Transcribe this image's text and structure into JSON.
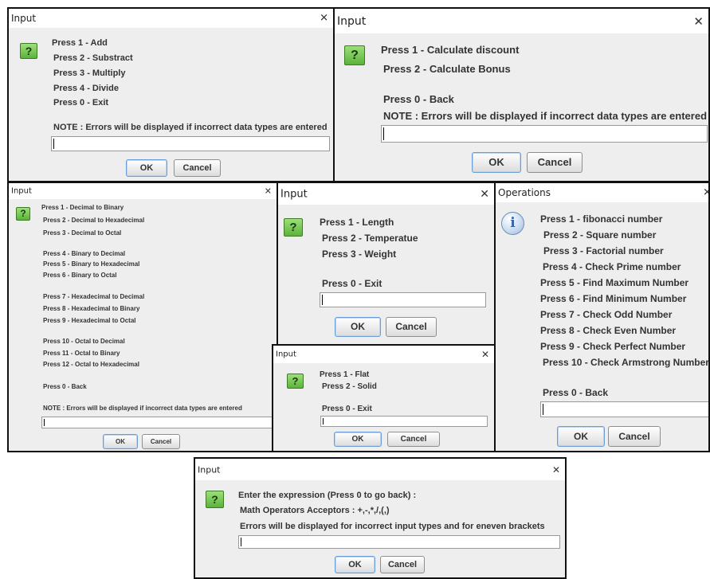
{
  "dialog_arith": {
    "title": "Input",
    "lines": [
      "Press 1 - Add",
      "Press 2 - Substract",
      "Press 3 - Multiply",
      "Press 4 - Divide",
      "Press 0 - Exit"
    ],
    "note": "NOTE : Errors will be displayed if incorrect data types are entered",
    "input_value": "",
    "ok": "OK",
    "cancel": "Cancel"
  },
  "dialog_discount": {
    "title": "Input",
    "lines": [
      "Press 1 - Calculate discount",
      "Press 2 - Calculate Bonus",
      "Press 0 - Back"
    ],
    "note": "NOTE : Errors will be displayed if incorrect data types are entered",
    "input_value": "",
    "ok": "OK",
    "cancel": "Cancel"
  },
  "dialog_convert": {
    "title": "Input",
    "lines": [
      "Press 1 - Decimal to Binary",
      "Press 2 - Decimal to Hexadecimal",
      "Press 3 - Decimal to Octal",
      "Press 4 - Binary to Decimal",
      "Press 5 - Binary to Hexadecimal",
      "Press 6 - Binary to Octal",
      "Press 7 - Hexadecimal to Decimal",
      "Press 8 - Hexadecimal to Binary",
      "Press 9 - Hexadecimal to Octal",
      "Press 10 - Octal to Decimal",
      "Press 11 - Octal to Binary",
      "Press 12 - Octal to Hexadecimal",
      "Press 0 - Back"
    ],
    "note": "NOTE : Errors will be displayed if incorrect data types are entered",
    "input_value": "",
    "ok": "OK",
    "cancel": "Cancel"
  },
  "dialog_units": {
    "title": "Input",
    "lines": [
      "Press 1 - Length",
      "Press 2 - Temperatue",
      "Press 3 - Weight",
      "Press 0 - Exit"
    ],
    "input_value": "",
    "ok": "OK",
    "cancel": "Cancel"
  },
  "dialog_area": {
    "title": "Input",
    "lines": [
      "Press 1 - Flat",
      "Press 2 - Solid",
      "Press 0 - Exit"
    ],
    "input_value": "",
    "ok": "OK",
    "cancel": "Cancel"
  },
  "dialog_operations": {
    "title": "Operations",
    "lines": [
      "Press 1 - fibonacci number",
      "Press 2 - Square number",
      "Press 3 - Factorial number",
      "Press 4 - Check Prime number",
      "Press 5 - Find Maximum Number",
      "Press 6 - Find Minimum Number",
      "Press 7 - Check Odd Number",
      "Press 8 - Check Even Number",
      "Press 9 - Check Perfect Number",
      "Press 10 - Check Armstrong Number",
      "Press 0 - Back"
    ],
    "input_value": "",
    "ok": "OK",
    "cancel": "Cancel"
  },
  "dialog_expression": {
    "title": "Input",
    "lines": [
      "Enter the expression (Press 0 to go back) :",
      "Math Operators Acceptors : +,-,*,/,(,)",
      "Errors will be displayed for incorrect input types and for eneven brackets"
    ],
    "input_value": "",
    "ok": "OK",
    "cancel": "Cancel"
  },
  "icons": {
    "question": "question-icon",
    "info": "info-icon",
    "close": "close-icon"
  },
  "glyphs": {
    "question": "?",
    "info": "i",
    "close": "✕"
  },
  "colors": {
    "dialog_bg": "#eeeeee",
    "title_bg": "#ffffff",
    "icon_green": "#5cb23c",
    "icon_info_blue": "#3a66a8",
    "text": "#333333"
  }
}
